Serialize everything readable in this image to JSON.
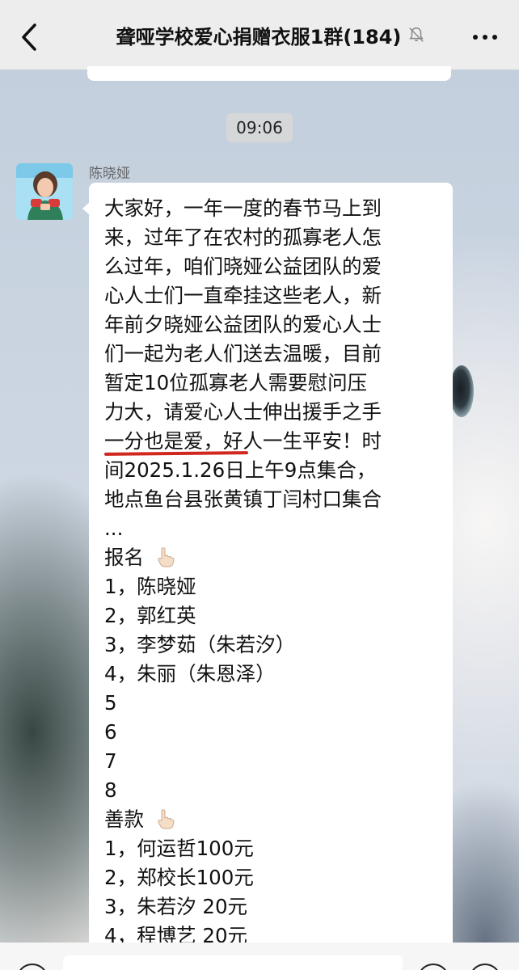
{
  "header": {
    "title": "聋哑学校爱心捐赠衣服1群(184)",
    "back_icon": "chevron-left-icon",
    "mute_icon": "bell-muted-icon",
    "more_icon": "more-dots-icon"
  },
  "chat": {
    "timestamp": "09:06",
    "message": {
      "sender": "陈晓娅",
      "lines": [
        "大家好，一年一度的春节马上到",
        "来，过年了在农村的孤寡老人怎",
        "么过年，咱们晓娅公益团队的爱",
        "心人士们一直牵挂这些老人，新",
        "年前夕晓娅公益团队的爱心人士",
        "们一起为老人们送去温暖，目前",
        "暂定10位孤寡老人需要慰问压",
        "力大，请爱心人士伸出援手之手",
        "一分也是爱，好人一生平安！时",
        "间2025.1.26日上午9点集合，",
        "地点鱼台县张黄镇丁闫村口集合",
        "...",
        "报名",
        "1，陈晓娅",
        "2，郭红英",
        "3，李梦茹（朱若汐）",
        "4，朱丽（朱恩泽）",
        "5",
        "6",
        "7",
        "8",
        "善款",
        "1，何运哲100元",
        "2，郑校长100元",
        "3，朱若汐 20元",
        "4，程博艺 20元"
      ],
      "emphasis_color": "#d0281e",
      "hand_icon": "pointing-down-hand-icon"
    }
  },
  "colors": {
    "header_bg": "#ededed",
    "bubble_bg": "#ffffff",
    "underline": "#d0281e"
  }
}
